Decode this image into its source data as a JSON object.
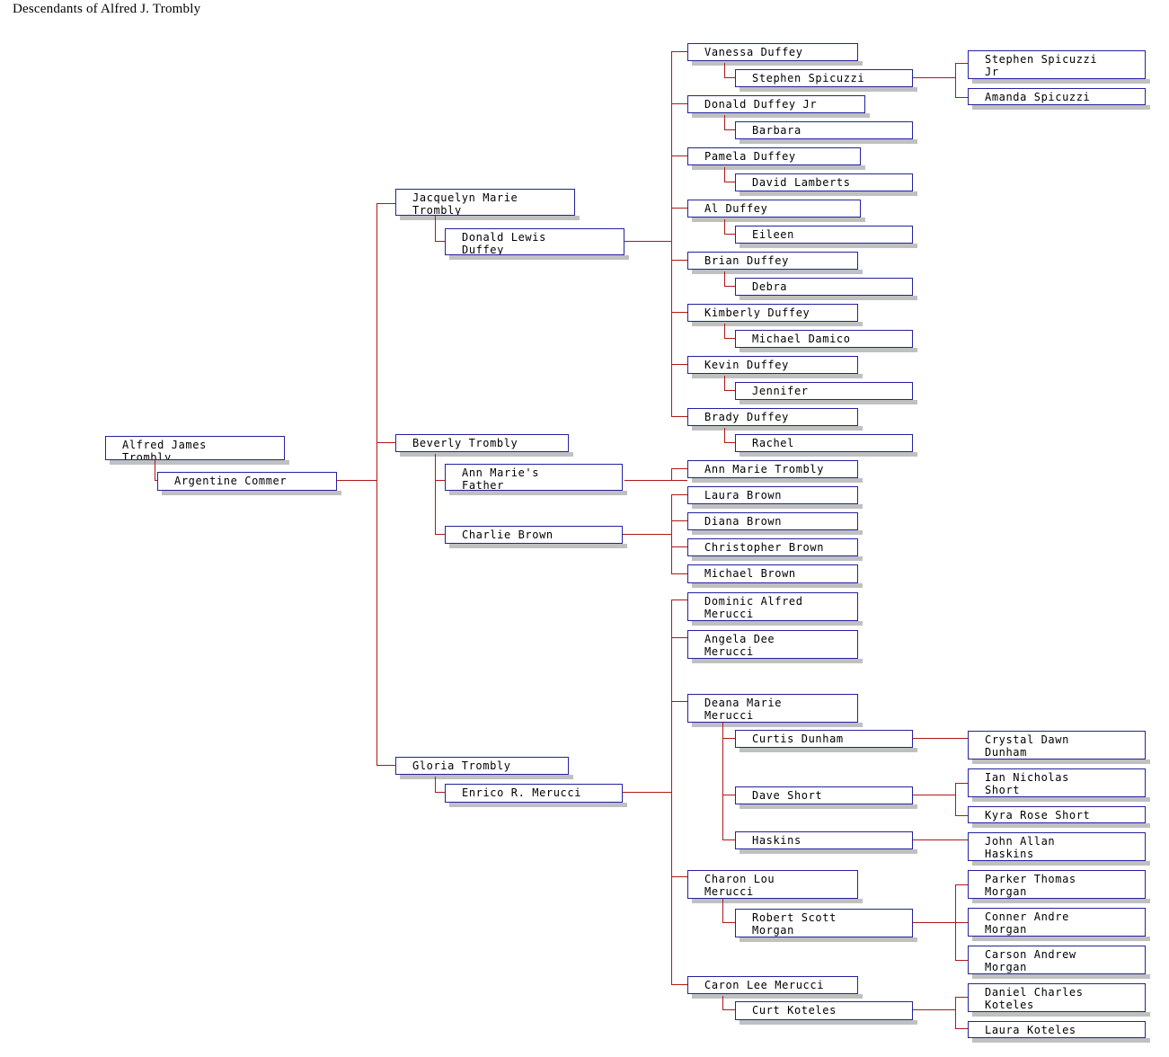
{
  "title": "Descendants of Alfred J. Trombly",
  "colors": {
    "box_border": "#22229c",
    "box_fill": "#ffffff",
    "box_shadow": "#c0c0c0",
    "connector": "#b01818",
    "text": "#000000",
    "background": "#ffffff"
  },
  "chart_data": {
    "type": "diagram",
    "diagram_kind": "descendant-tree",
    "title": "Descendants of Alfred J. Trombly",
    "root": "Alfred James Trombly",
    "generations": 5,
    "node_count": 48
  },
  "nodes": {
    "n0": {
      "label": "Alfred James\nTrombly"
    },
    "n1": {
      "label": "Argentine Commer"
    },
    "n2": {
      "label": "Jacquelyn Marie\nTrombly"
    },
    "n3": {
      "label": "Donald Lewis\nDuffey"
    },
    "n4": {
      "label": "Vanessa Duffey"
    },
    "n5": {
      "label": "Stephen Spicuzzi"
    },
    "n6": {
      "label": "Stephen Spicuzzi\nJr"
    },
    "n7": {
      "label": "Amanda Spicuzzi"
    },
    "n8": {
      "label": "Donald Duffey Jr"
    },
    "n9": {
      "label": "Barbara"
    },
    "n10": {
      "label": "Pamela Duffey"
    },
    "n11": {
      "label": "David Lamberts"
    },
    "n12": {
      "label": "Al Duffey"
    },
    "n13": {
      "label": "Eileen"
    },
    "n14": {
      "label": "Brian Duffey"
    },
    "n15": {
      "label": "Debra"
    },
    "n16": {
      "label": "Kimberly Duffey"
    },
    "n17": {
      "label": "Michael Damico"
    },
    "n18": {
      "label": "Kevin Duffey"
    },
    "n19": {
      "label": "Jennifer"
    },
    "n20": {
      "label": "Brady Duffey"
    },
    "n21": {
      "label": "Rachel"
    },
    "n22": {
      "label": "Beverly Trombly"
    },
    "n23": {
      "label": "Ann Marie's\nFather"
    },
    "n24": {
      "label": "Charlie Brown"
    },
    "n25": {
      "label": "Ann Marie Trombly"
    },
    "n26": {
      "label": "Laura Brown"
    },
    "n27": {
      "label": "Diana Brown"
    },
    "n28": {
      "label": "Christopher Brown"
    },
    "n29": {
      "label": "Michael Brown"
    },
    "n30": {
      "label": "Dominic Alfred\nMerucci"
    },
    "n31": {
      "label": "Angela Dee\nMerucci"
    },
    "n32": {
      "label": "Deana Marie\nMerucci"
    },
    "n33": {
      "label": "Curtis Dunham"
    },
    "n34": {
      "label": "Crystal Dawn\nDunham"
    },
    "n35": {
      "label": "Dave Short"
    },
    "n36": {
      "label": "Ian Nicholas\nShort"
    },
    "n37": {
      "label": "Kyra Rose Short"
    },
    "n38": {
      "label": "Haskins"
    },
    "n39": {
      "label": "John Allan\nHaskins"
    },
    "n40": {
      "label": "Gloria Trombly"
    },
    "n41": {
      "label": "Enrico R. Merucci"
    },
    "n42": {
      "label": "Charon Lou\nMerucci"
    },
    "n43": {
      "label": "Robert Scott\nMorgan"
    },
    "n44": {
      "label": "Parker Thomas\nMorgan"
    },
    "n45": {
      "label": "Conner Andre\nMorgan"
    },
    "n46": {
      "label": "Carson Andrew\nMorgan"
    },
    "n47": {
      "label": "Caron Lee Merucci"
    },
    "n48": {
      "label": "Curt Koteles"
    },
    "n49": {
      "label": "Daniel Charles\nKoteles"
    },
    "n50": {
      "label": "Laura Koteles"
    }
  }
}
